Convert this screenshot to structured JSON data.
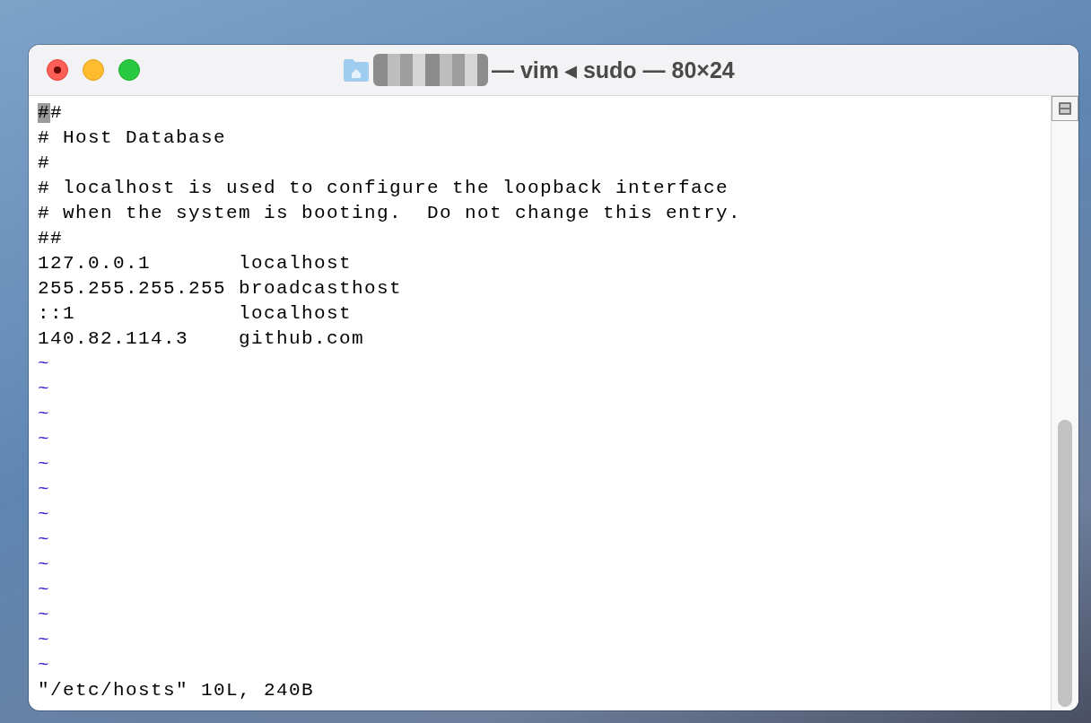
{
  "window": {
    "title": "— vim ◂ sudo — 80×24",
    "title_redacted": true
  },
  "editor": {
    "lines": [
      {
        "kind": "text",
        "text": "##",
        "cursor": true
      },
      {
        "kind": "text",
        "text": "# Host Database",
        "cursor": false
      },
      {
        "kind": "text",
        "text": "#",
        "cursor": false
      },
      {
        "kind": "text",
        "text": "# localhost is used to configure the loopback interface",
        "cursor": false
      },
      {
        "kind": "text",
        "text": "# when the system is booting.  Do not change this entry.",
        "cursor": false
      },
      {
        "kind": "text",
        "text": "##",
        "cursor": false
      },
      {
        "kind": "text",
        "text": "127.0.0.1       localhost",
        "cursor": false
      },
      {
        "kind": "text",
        "text": "255.255.255.255 broadcasthost",
        "cursor": false
      },
      {
        "kind": "text",
        "text": "::1             localhost",
        "cursor": false
      },
      {
        "kind": "text",
        "text": "140.82.114.3    github.com",
        "cursor": false
      },
      {
        "kind": "tilde",
        "text": "~"
      },
      {
        "kind": "tilde",
        "text": "~"
      },
      {
        "kind": "tilde",
        "text": "~"
      },
      {
        "kind": "tilde",
        "text": "~"
      },
      {
        "kind": "tilde",
        "text": "~"
      },
      {
        "kind": "tilde",
        "text": "~"
      },
      {
        "kind": "tilde",
        "text": "~"
      },
      {
        "kind": "tilde",
        "text": "~"
      },
      {
        "kind": "tilde",
        "text": "~"
      },
      {
        "kind": "tilde",
        "text": "~"
      },
      {
        "kind": "tilde",
        "text": "~"
      },
      {
        "kind": "tilde",
        "text": "~"
      },
      {
        "kind": "tilde",
        "text": "~"
      }
    ],
    "status_line": "\"/etc/hosts\" 10L, 240B"
  }
}
